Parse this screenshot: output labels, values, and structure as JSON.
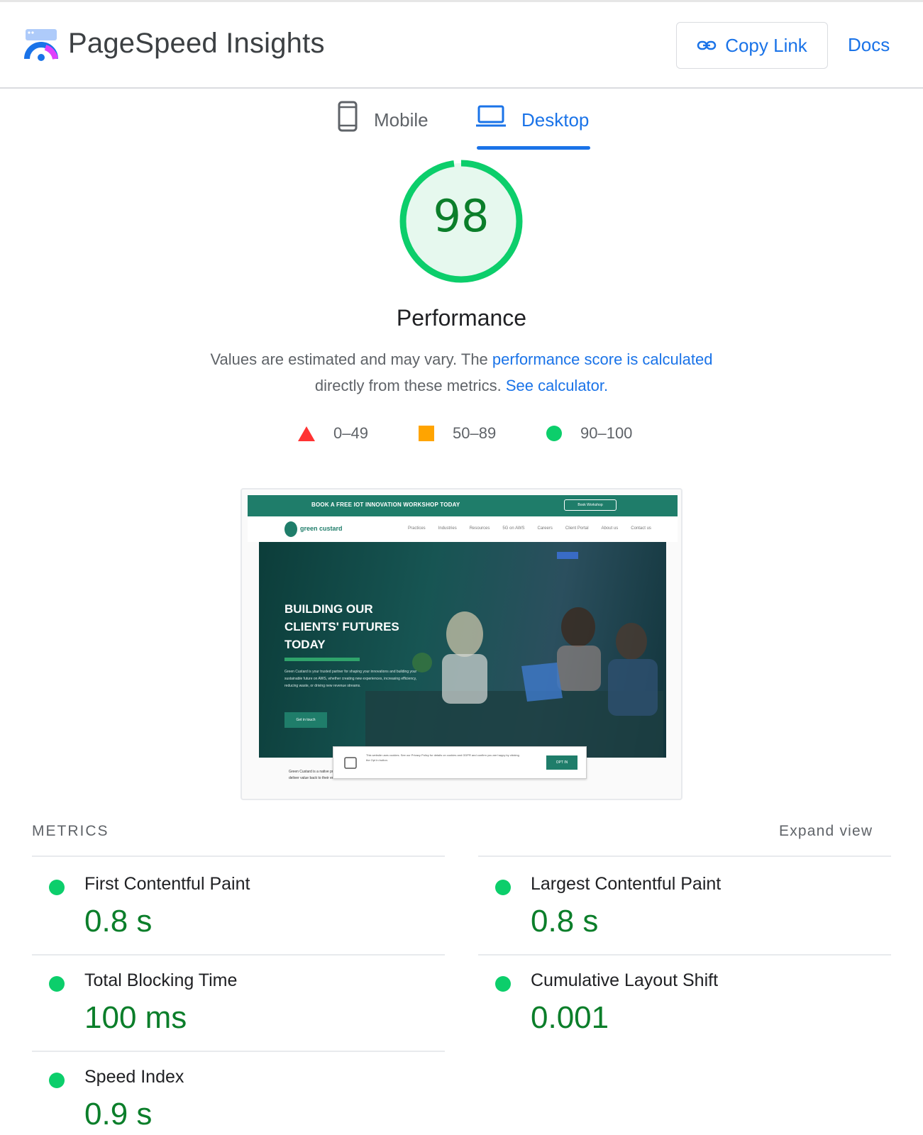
{
  "header": {
    "app_title": "PageSpeed Insights",
    "copy_link_label": "Copy Link",
    "docs_label": "Docs"
  },
  "tabs": [
    {
      "label": "Mobile",
      "active": false
    },
    {
      "label": "Desktop",
      "active": true
    }
  ],
  "score": {
    "value": 98,
    "label": "Performance",
    "color": "#0cce6b"
  },
  "description": {
    "prefix": "Values are estimated and may vary. The ",
    "link1": "performance score is calculated",
    "middle": " directly from these metrics. ",
    "link2": "See calculator."
  },
  "legend": [
    {
      "range": "0–49",
      "shape": "triangle",
      "color": "#ff3333"
    },
    {
      "range": "50–89",
      "shape": "square",
      "color": "#ffa400"
    },
    {
      "range": "90–100",
      "shape": "circle",
      "color": "#0cce6b"
    }
  ],
  "thumbnail": {
    "banner_text": "BOOK A FREE IOT INNOVATION WORKSHOP TODAY",
    "banner_button": "Book Workshop",
    "logo_text": "green custard",
    "nav_links": [
      "Practices",
      "Industries",
      "Resources",
      "5G on AWS",
      "Careers",
      "Client Portal",
      "About us",
      "Contact us"
    ],
    "hero_title": "BUILDING OUR CLIENTS' FUTURES TODAY",
    "hero_body": "Green Custard is your trusted partner for shaping your innovations and building your sustainable future on AWS, whether creating new experiences, increasing efficiency, reducing waste, or driving new revenue streams.",
    "hero_button": "Get in touch",
    "cookie_text": "This website uses cookies. See our Privacy Policy for details on cookies and GDPR and confirm you are happy by clicking the Opt In button.",
    "cookie_button": "OPT IN",
    "bottom_text": "Green Custard is a native professional services company. We help IoT businesses innovate and deliver value back to their end customers. We are"
  },
  "metrics": {
    "heading": "METRICS",
    "expand_label": "Expand view",
    "items": [
      {
        "label": "First Contentful Paint",
        "value": "0.8 s"
      },
      {
        "label": "Largest Contentful Paint",
        "value": "0.8 s"
      },
      {
        "label": "Total Blocking Time",
        "value": "100 ms"
      },
      {
        "label": "Cumulative Layout Shift",
        "value": "0.001"
      },
      {
        "label": "Speed Index",
        "value": "0.9 s"
      }
    ]
  }
}
